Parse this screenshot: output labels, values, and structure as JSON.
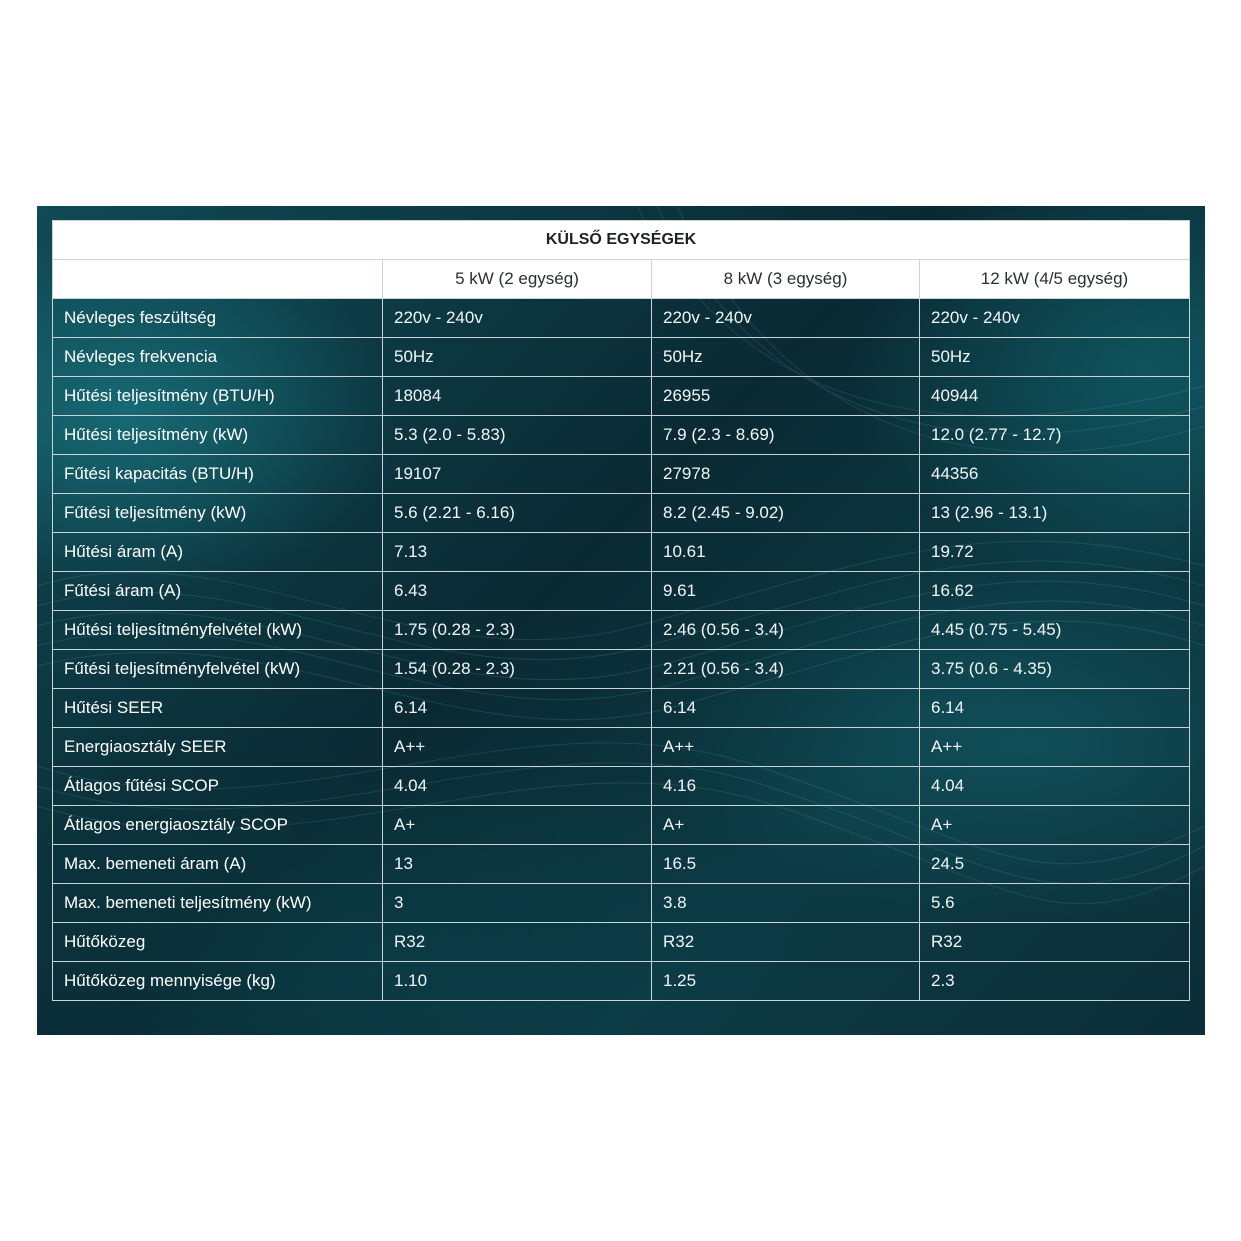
{
  "table": {
    "title": "KÜLSŐ EGYSÉGEK",
    "corner": "",
    "columns": [
      "5 kW (2 egység)",
      "8 kW (3 egység)",
      "12 kW (4/5 egység)"
    ],
    "rows": [
      {
        "label": "Névleges feszültség",
        "values": [
          "220v - 240v",
          "220v - 240v",
          "220v - 240v"
        ]
      },
      {
        "label": "Névleges frekvencia",
        "values": [
          "50Hz",
          "50Hz",
          "50Hz"
        ]
      },
      {
        "label": "Hűtési teljesítmény (BTU/H)",
        "values": [
          "18084",
          "26955",
          "40944"
        ]
      },
      {
        "label": "Hűtési teljesítmény (kW)",
        "values": [
          "5.3 (2.0 - 5.83)",
          "7.9 (2.3 - 8.69)",
          "12.0 (2.77 - 12.7)"
        ]
      },
      {
        "label": "Fűtési kapacitás (BTU/H)",
        "values": [
          "19107",
          "27978",
          "44356"
        ]
      },
      {
        "label": "Fűtési teljesítmény (kW)",
        "values": [
          "5.6 (2.21 - 6.16)",
          "8.2 (2.45 - 9.02)",
          "13 (2.96 - 13.1)"
        ]
      },
      {
        "label": "Hűtési áram (A)",
        "values": [
          "7.13",
          "10.61",
          "19.72"
        ]
      },
      {
        "label": "Fűtési áram (A)",
        "values": [
          "6.43",
          "9.61",
          "16.62"
        ]
      },
      {
        "label": "Hűtési teljesítményfelvétel (kW)",
        "values": [
          "1.75 (0.28 - 2.3)",
          "2.46 (0.56 - 3.4)",
          "4.45 (0.75 - 5.45)"
        ]
      },
      {
        "label": "Fűtési teljesítményfelvétel (kW)",
        "values": [
          "1.54 (0.28 - 2.3)",
          "2.21 (0.56 - 3.4)",
          "3.75 (0.6 - 4.35)"
        ]
      },
      {
        "label": "Hűtési SEER",
        "values": [
          "6.14",
          "6.14",
          "6.14"
        ]
      },
      {
        "label": "Energiaosztály SEER",
        "values": [
          "A++",
          "A++",
          "A++"
        ]
      },
      {
        "label": "Átlagos fűtési SCOP",
        "values": [
          "4.04",
          "4.16",
          "4.04"
        ]
      },
      {
        "label": "Átlagos energiaosztály SCOP",
        "values": [
          "A+",
          "A+",
          "A+"
        ]
      },
      {
        "label": "Max. bemeneti áram (A)",
        "values": [
          "13",
          "16.5",
          "24.5"
        ]
      },
      {
        "label": "Max. bemeneti teljesítmény (kW)",
        "values": [
          "3",
          "3.8",
          "5.6"
        ]
      },
      {
        "label": "Hűtőközeg",
        "values": [
          "R32",
          "R32",
          "R32"
        ]
      },
      {
        "label": "Hűtőközeg mennyisége (kg)",
        "values": [
          "1.10",
          "1.25",
          "2.3"
        ]
      }
    ]
  },
  "colors": {
    "panel_dark": "#0a2a33",
    "panel_teal": "#0f4a55",
    "grid_line": "#c9d4d8",
    "header_bg": "#ffffff",
    "text_light": "#f2f6f7"
  }
}
